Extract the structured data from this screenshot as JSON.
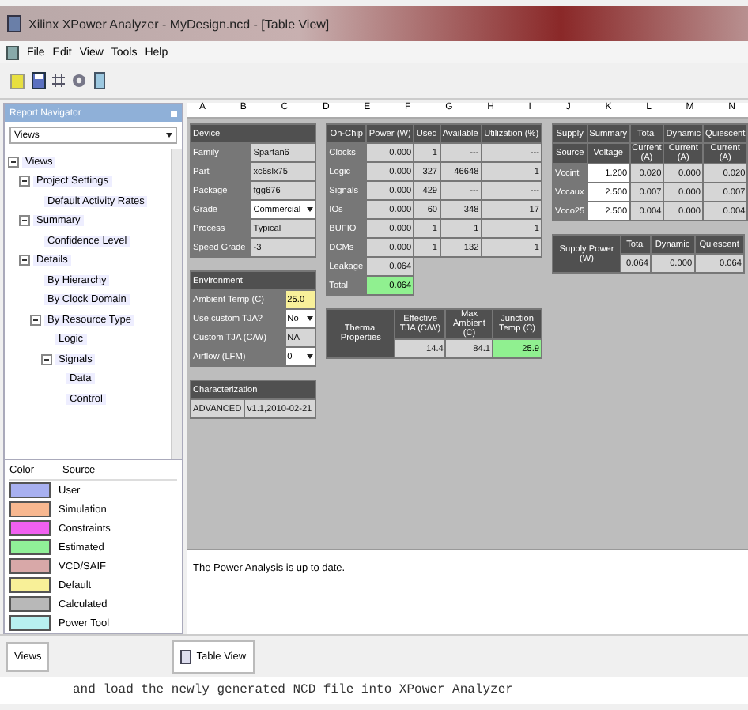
{
  "window": {
    "title": "Xilinx XPower Analyzer - MyDesign.ncd - [Table View]"
  },
  "menu": [
    "File",
    "Edit",
    "View",
    "Tools",
    "Help"
  ],
  "navigator": {
    "title": "Report Navigator",
    "dropdown": "Views",
    "tree": [
      {
        "label": "Views",
        "expanded": true,
        "children": [
          {
            "label": "Project Settings",
            "expanded": true,
            "children": [
              {
                "label": "Default Activity Rates"
              }
            ]
          },
          {
            "label": "Summary",
            "expanded": true,
            "children": [
              {
                "label": "Confidence Level"
              }
            ]
          },
          {
            "label": "Details",
            "expanded": true,
            "children": [
              {
                "label": "By Hierarchy"
              },
              {
                "label": "By Clock Domain"
              },
              {
                "label": "By Resource Type",
                "expanded": true,
                "children": [
                  {
                    "label": "Logic"
                  },
                  {
                    "label": "Signals",
                    "expanded": true,
                    "children": [
                      {
                        "label": "Data"
                      },
                      {
                        "label": "Control"
                      }
                    ]
                  }
                ]
              }
            ]
          }
        ]
      }
    ]
  },
  "legend": {
    "columns": [
      "Color",
      "Source"
    ],
    "items": [
      {
        "label": "User",
        "color": "#a8b0f0"
      },
      {
        "label": "Simulation",
        "color": "#f8b890"
      },
      {
        "label": "Constraints",
        "color": "#f060f0"
      },
      {
        "label": "Estimated",
        "color": "#90f098"
      },
      {
        "label": "VCD/SAIF",
        "color": "#d8a8a8"
      },
      {
        "label": "Default",
        "color": "#f8f098"
      },
      {
        "label": "Calculated",
        "color": "#b8b8b8"
      },
      {
        "label": "Power Tool",
        "color": "#b8f0f0"
      }
    ]
  },
  "sheet": {
    "column_headers": [
      "A",
      "B",
      "C",
      "D",
      "E",
      "F",
      "G",
      "H",
      "I",
      "J",
      "K",
      "L",
      "M",
      "N"
    ],
    "left_tables": [
      {
        "title": "Device",
        "rows": [
          [
            {
              "text": "Family",
              "kind": "label"
            },
            {
              "text": "Spartan6",
              "kind": "value"
            }
          ],
          [
            {
              "text": "Part",
              "kind": "label"
            },
            {
              "text": "xc6slx75",
              "kind": "value"
            }
          ],
          [
            {
              "text": "Package",
              "kind": "label"
            },
            {
              "text": "fgg676",
              "kind": "value"
            }
          ],
          [
            {
              "text": "Grade",
              "kind": "label"
            },
            {
              "text": "Commercial",
              "kind": "dropdown"
            }
          ],
          [
            {
              "text": "Process",
              "kind": "label"
            },
            {
              "text": "Typical",
              "kind": "value"
            }
          ],
          [
            {
              "text": "Speed Grade",
              "kind": "label"
            },
            {
              "text": "-3",
              "kind": "value"
            }
          ]
        ]
      },
      {
        "title": "Environment",
        "rows": [
          [
            {
              "text": "Ambient Temp (C)",
              "kind": "label"
            },
            {
              "text": "25.0",
              "kind": "yellow"
            }
          ],
          [
            {
              "text": "Use custom TJA?",
              "kind": "label"
            },
            {
              "text": "No",
              "kind": "dropdown"
            }
          ],
          [
            {
              "text": "Custom TJA (C/W)",
              "kind": "label"
            },
            {
              "text": "NA",
              "kind": "value"
            }
          ],
          [
            {
              "text": "Airflow (LFM)",
              "kind": "label"
            },
            {
              "text": "0",
              "kind": "dropdown"
            }
          ]
        ]
      },
      {
        "title": "Characterization",
        "rows": [
          [
            {
              "text": "ADVANCED",
              "kind": "value"
            },
            {
              "text": "v1.1,2010-02-21",
              "kind": "value"
            }
          ]
        ]
      }
    ],
    "middle_tables": [
      {
        "rows": [
          [
            {
              "text": "On-Chip",
              "kind": "header"
            },
            {
              "text": "Power (W)",
              "kind": "header"
            },
            {
              "text": "Used",
              "kind": "header"
            },
            {
              "text": "Available",
              "kind": "header"
            },
            {
              "text": "Utilization (%)",
              "kind": "header"
            }
          ],
          [
            {
              "text": "Clocks",
              "kind": "label"
            },
            {
              "text": "0.000",
              "kind": "number"
            },
            {
              "text": "1",
              "kind": "number"
            },
            {
              "text": "---",
              "kind": "number"
            },
            {
              "text": "---",
              "kind": "number"
            }
          ],
          [
            {
              "text": "Logic",
              "kind": "label"
            },
            {
              "text": "0.000",
              "kind": "number"
            },
            {
              "text": "327",
              "kind": "number"
            },
            {
              "text": "46648",
              "kind": "number"
            },
            {
              "text": "1",
              "kind": "number"
            }
          ],
          [
            {
              "text": "Signals",
              "kind": "label"
            },
            {
              "text": "0.000",
              "kind": "number"
            },
            {
              "text": "429",
              "kind": "number"
            },
            {
              "text": "---",
              "kind": "number"
            },
            {
              "text": "---",
              "kind": "number"
            }
          ],
          [
            {
              "text": "IOs",
              "kind": "label"
            },
            {
              "text": "0.000",
              "kind": "number"
            },
            {
              "text": "60",
              "kind": "number"
            },
            {
              "text": "348",
              "kind": "number"
            },
            {
              "text": "17",
              "kind": "number"
            }
          ],
          [
            {
              "text": "BUFIO",
              "kind": "label"
            },
            {
              "text": "0.000",
              "kind": "number"
            },
            {
              "text": "1",
              "kind": "number"
            },
            {
              "text": "1",
              "kind": "number"
            },
            {
              "text": "1",
              "kind": "number"
            }
          ],
          [
            {
              "text": "DCMs",
              "kind": "label"
            },
            {
              "text": "0.000",
              "kind": "number"
            },
            {
              "text": "1",
              "kind": "number"
            },
            {
              "text": "132",
              "kind": "number"
            },
            {
              "text": "1",
              "kind": "number"
            }
          ],
          [
            {
              "text": "Leakage",
              "kind": "label"
            },
            {
              "text": "0.064",
              "kind": "number"
            }
          ],
          [
            {
              "text": "Total",
              "kind": "label"
            },
            {
              "text": "0.064",
              "kind": "green"
            }
          ]
        ]
      },
      {
        "side_title": "Thermal Properties",
        "rows": [
          [
            {
              "text": "Effective TJA (C/W)",
              "kind": "header"
            },
            {
              "text": "Max Ambient (C)",
              "kind": "header"
            },
            {
              "text": "Junction Temp (C)",
              "kind": "header"
            }
          ],
          [
            {
              "text": "14.4",
              "kind": "number"
            },
            {
              "text": "84.1",
              "kind": "number"
            },
            {
              "text": "25.9",
              "kind": "green"
            }
          ]
        ]
      }
    ],
    "right_tables": [
      {
        "rows": [
          [
            {
              "text": "Supply",
              "kind": "header"
            },
            {
              "text": "Summary",
              "kind": "header"
            },
            {
              "text": "Total",
              "kind": "header"
            },
            {
              "text": "Dynamic",
              "kind": "header"
            },
            {
              "text": "Quiescent",
              "kind": "header"
            }
          ],
          [
            {
              "text": "Source",
              "kind": "header"
            },
            {
              "text": "Voltage",
              "kind": "header"
            },
            {
              "text": "Current (A)",
              "kind": "header"
            },
            {
              "text": "Current (A)",
              "kind": "header"
            },
            {
              "text": "Current (A)",
              "kind": "header"
            }
          ],
          [
            {
              "text": "Vccint",
              "kind": "label"
            },
            {
              "text": "1.200",
              "kind": "input"
            },
            {
              "text": "0.020",
              "kind": "number"
            },
            {
              "text": "0.000",
              "kind": "number"
            },
            {
              "text": "0.020",
              "kind": "number"
            }
          ],
          [
            {
              "text": "Vccaux",
              "kind": "label"
            },
            {
              "text": "2.500",
              "kind": "input"
            },
            {
              "text": "0.007",
              "kind": "number"
            },
            {
              "text": "0.000",
              "kind": "number"
            },
            {
              "text": "0.007",
              "kind": "number"
            }
          ],
          [
            {
              "text": "Vcco25",
              "kind": "label"
            },
            {
              "text": "2.500",
              "kind": "input"
            },
            {
              "text": "0.004",
              "kind": "number"
            },
            {
              "text": "0.000",
              "kind": "number"
            },
            {
              "text": "0.004",
              "kind": "number"
            }
          ]
        ]
      },
      {
        "side_title": "Supply Power (W)",
        "rows": [
          [
            {
              "text": "Total",
              "kind": "header"
            },
            {
              "text": "Dynamic",
              "kind": "header"
            },
            {
              "text": "Quiescent",
              "kind": "header"
            }
          ],
          [
            {
              "text": "0.064",
              "kind": "number"
            },
            {
              "text": "0.000",
              "kind": "number"
            },
            {
              "text": "0.064",
              "kind": "number"
            }
          ]
        ]
      }
    ]
  },
  "message": "The Power Analysis is up to date.",
  "bottom_tabs": {
    "left": "Views",
    "right": "Table View"
  },
  "background_text": "and load the newly generated NCD file into XPower Analyzer"
}
